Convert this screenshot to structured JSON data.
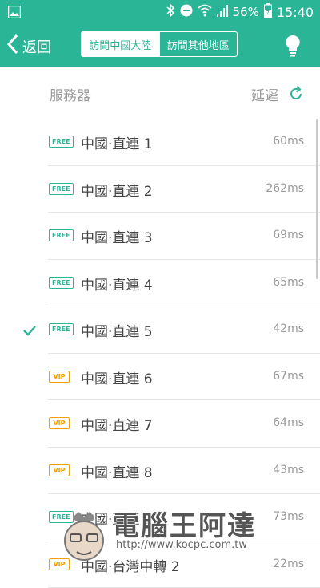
{
  "status_bar": {
    "battery": "56%",
    "time": "15:40"
  },
  "app_bar": {
    "back_label": "返回",
    "tabs": [
      {
        "label": "訪問中國大陸",
        "active": true
      },
      {
        "label": "訪問其他地區",
        "active": false
      }
    ]
  },
  "list_header": {
    "server_label": "服務器",
    "latency_label": "延遲"
  },
  "servers": [
    {
      "badge": "FREE",
      "tier": "free",
      "name": "中國·直連 1",
      "latency": "60ms",
      "selected": false
    },
    {
      "badge": "FREE",
      "tier": "free",
      "name": "中國·直連 2",
      "latency": "262ms",
      "selected": false
    },
    {
      "badge": "FREE",
      "tier": "free",
      "name": "中國·直連 3",
      "latency": "69ms",
      "selected": false
    },
    {
      "badge": "FREE",
      "tier": "free",
      "name": "中國·直連 4",
      "latency": "65ms",
      "selected": false
    },
    {
      "badge": "FREE",
      "tier": "free",
      "name": "中國·直連 5",
      "latency": "42ms",
      "selected": true
    },
    {
      "badge": "VIP",
      "tier": "vip",
      "name": "中國·直連 6",
      "latency": "67ms",
      "selected": false
    },
    {
      "badge": "VIP",
      "tier": "vip",
      "name": "中國·直連 7",
      "latency": "64ms",
      "selected": false
    },
    {
      "badge": "VIP",
      "tier": "vip",
      "name": "中國·直連 8",
      "latency": "43ms",
      "selected": false
    },
    {
      "badge": "FREE",
      "tier": "free",
      "name": "中國·直連 11",
      "latency": "73ms",
      "selected": false
    },
    {
      "badge": "VIP",
      "tier": "vip",
      "name": "中國·台灣中轉 2",
      "latency": "22ms",
      "selected": false
    }
  ],
  "watermark": {
    "title": "電腦王阿達",
    "url": "http://www.kocpc.com.tw"
  },
  "colors": {
    "accent": "#2bb597",
    "vip": "#f2a000"
  }
}
